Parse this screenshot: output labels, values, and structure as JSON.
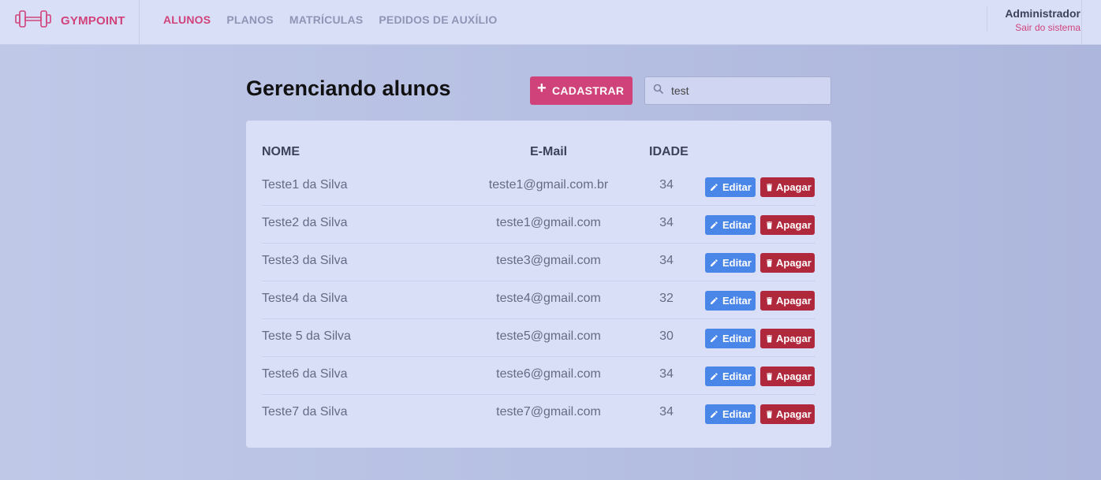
{
  "brand": {
    "name": "GYMPOINT",
    "color": "#d0437a"
  },
  "nav": {
    "items": [
      {
        "label": "ALUNOS",
        "active": true
      },
      {
        "label": "PLANOS",
        "active": false
      },
      {
        "label": "MATRÍCULAS",
        "active": false
      },
      {
        "label": "PEDIDOS DE AUXÍLIO",
        "active": false
      }
    ]
  },
  "user": {
    "name": "Administrador",
    "logout_label": "Sair do sistema"
  },
  "page": {
    "title": "Gerenciando alunos"
  },
  "toolbar": {
    "add_label": "CADASTRAR",
    "add_icon": "plus-icon"
  },
  "search": {
    "value": "test",
    "icon": "search-icon"
  },
  "table": {
    "headers": {
      "name": "NOME",
      "email": "E-Mail",
      "age": "IDADE"
    },
    "edit_label": "Editar",
    "delete_label": "Apagar",
    "rows": [
      {
        "name": "Teste1 da Silva",
        "email": "teste1@gmail.com.br",
        "age": "34"
      },
      {
        "name": "Teste2 da Silva",
        "email": "teste1@gmail.com",
        "age": "34"
      },
      {
        "name": "Teste3 da Silva",
        "email": "teste3@gmail.com",
        "age": "34"
      },
      {
        "name": "Teste4 da Silva",
        "email": "teste4@gmail.com",
        "age": "32"
      },
      {
        "name": "Teste 5 da Silva",
        "email": "teste5@gmail.com",
        "age": "30"
      },
      {
        "name": "Teste6 da Silva",
        "email": "teste6@gmail.com",
        "age": "34"
      },
      {
        "name": "Teste7 da Silva",
        "email": "teste7@gmail.com",
        "age": "34"
      }
    ]
  },
  "colors": {
    "accent": "#d0437a",
    "edit": "#4a86e8",
    "delete": "#b0283c"
  }
}
